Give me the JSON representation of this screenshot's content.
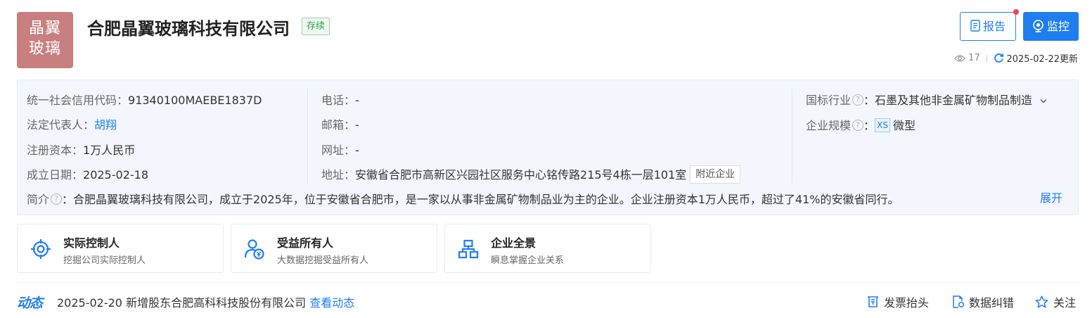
{
  "company": {
    "logo_line1": "晶翼",
    "logo_line2": "玻璃",
    "name": "合肥晶翼玻璃科技有限公司",
    "status": "存续"
  },
  "header_actions": {
    "report_label": "报告",
    "monitor_label": "监控",
    "view_count": "17",
    "update_text": "2025-02-22更新"
  },
  "info": {
    "credit_code_label": "统一社会信用代码：",
    "credit_code": "91340100MAEBE1837D",
    "legal_rep_label": "法定代表人：",
    "legal_rep": "胡翔",
    "capital_label": "注册资本：",
    "capital": "1万人民币",
    "founded_label": "成立日期：",
    "founded": "2025-02-18",
    "phone_label": "电话：",
    "phone": "-",
    "email_label": "邮箱：",
    "email": "-",
    "website_label": "网址：",
    "website": "-",
    "address_label": "地址：",
    "address": "安徽省合肥市高新区兴园社区服务中心铭传路215号4栋一层101室",
    "nearby_label": "附近企业",
    "industry_label": "国标行业",
    "industry": "石墨及其他非金属矿物制品制造",
    "scale_label": "企业规模",
    "scale_tag": "XS",
    "scale": "微型",
    "intro_label": "简介",
    "intro": "合肥晶翼玻璃科技有限公司，成立于2025年，位于安徽省合肥市，是一家以从事非金属矿物制品业为主的企业。企业注册资本1万人民币，超过了41%的安徽省同行。",
    "expand_label": "展开"
  },
  "cards": [
    {
      "title": "实际控制人",
      "subtitle": "挖掘公司实际控制人",
      "icon": "target-icon"
    },
    {
      "title": "受益所有人",
      "subtitle": "大数据挖掘受益所有人",
      "icon": "beneficiary-icon"
    },
    {
      "title": "企业全景",
      "subtitle": "瞬息掌握企业关系",
      "icon": "org-chart-icon"
    }
  ],
  "dynamics": {
    "logo": "动态",
    "date": "2025-02-20",
    "text": "新增股东合肥高科科技股份有限公司",
    "link": "查看动态"
  },
  "bottom_actions": {
    "invoice_label": "发票抬头",
    "correction_label": "数据纠错",
    "follow_label": "关注"
  },
  "colors": {
    "accent": "#1e7ef0",
    "logo_bg": "#c97f7f",
    "status_green": "#2f9f4b",
    "info_bg": "#f3f7fd"
  }
}
